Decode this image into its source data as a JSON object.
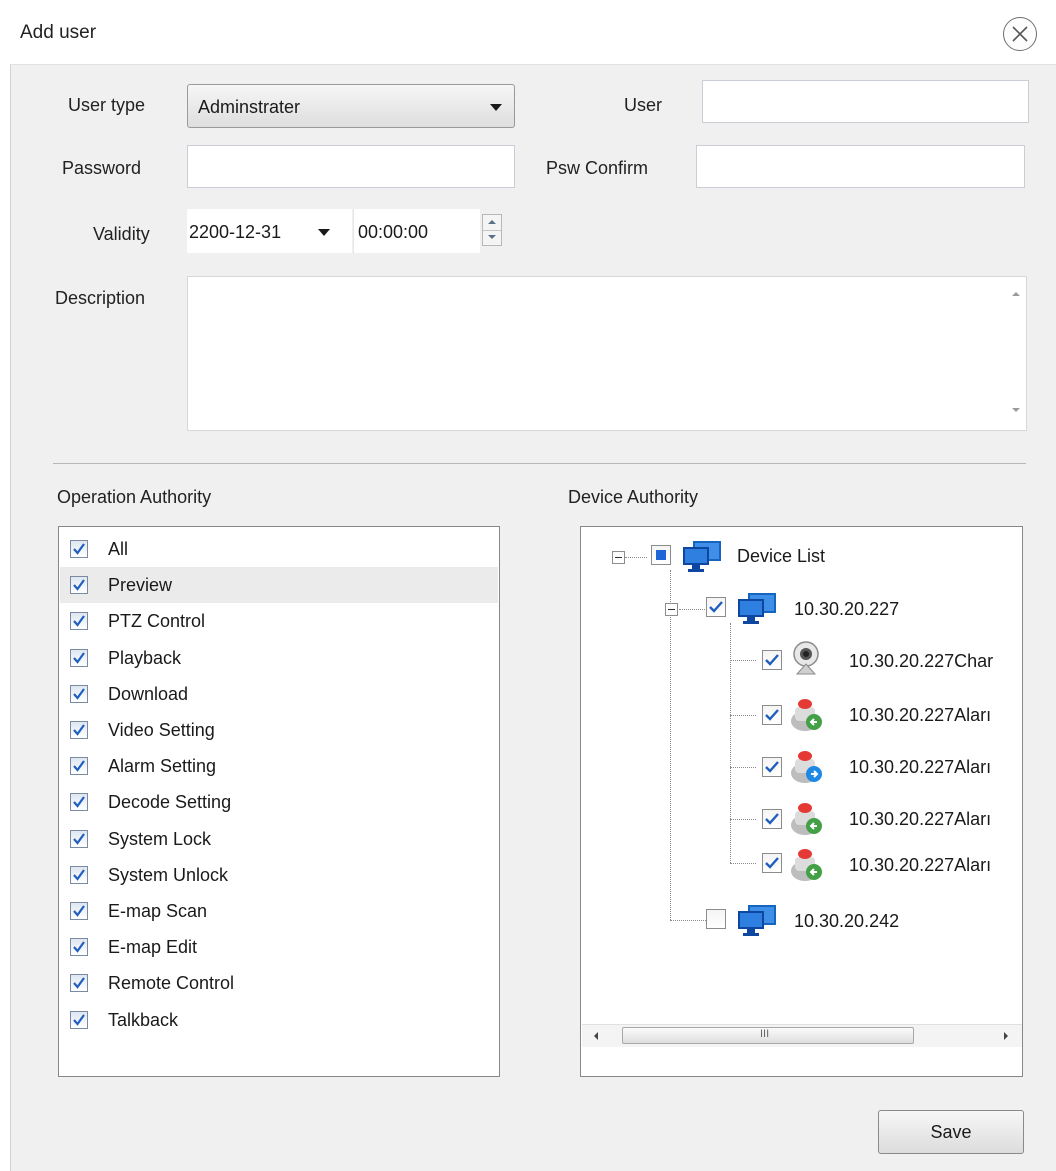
{
  "window": {
    "title": "Add user"
  },
  "form": {
    "user_type_label": "User type",
    "user_type_value": "Adminstrater",
    "user_label": "User",
    "user_value": "",
    "password_label": "Password",
    "password_value": "",
    "psw_confirm_label": "Psw Confirm",
    "psw_confirm_value": "",
    "validity_label": "Validity",
    "validity_date": "2200-12-31",
    "validity_time": "00:00:00",
    "description_label": "Description",
    "description_value": ""
  },
  "operation": {
    "heading": "Operation Authority",
    "items": [
      {
        "label": "All",
        "checked": true
      },
      {
        "label": "Preview",
        "checked": true,
        "selected": true
      },
      {
        "label": "PTZ Control",
        "checked": true
      },
      {
        "label": "Playback",
        "checked": true
      },
      {
        "label": "Download",
        "checked": true
      },
      {
        "label": "Video Setting",
        "checked": true
      },
      {
        "label": "Alarm Setting",
        "checked": true
      },
      {
        "label": "Decode Setting",
        "checked": true
      },
      {
        "label": "System Lock",
        "checked": true
      },
      {
        "label": "System Unlock",
        "checked": true
      },
      {
        "label": "E-map Scan",
        "checked": true
      },
      {
        "label": "E-map Edit",
        "checked": true
      },
      {
        "label": "Remote Control",
        "checked": true
      },
      {
        "label": "Talkback",
        "checked": true
      }
    ]
  },
  "device": {
    "heading": "Device Authority",
    "root": {
      "label": "Device List",
      "state": "partial",
      "icon": "monitor-icon"
    },
    "nodes": [
      {
        "label": "10.30.20.227",
        "checked": true,
        "icon": "monitor-icon"
      },
      {
        "label": "10.30.20.227Char",
        "checked": true,
        "icon": "webcam-icon"
      },
      {
        "label": "10.30.20.227Aları",
        "checked": true,
        "icon": "alarm-in-icon"
      },
      {
        "label": "10.30.20.227Aları",
        "checked": true,
        "icon": "alarm-out-icon"
      },
      {
        "label": "10.30.20.227Aları",
        "checked": true,
        "icon": "alarm-in-icon"
      },
      {
        "label": "10.30.20.227Aları",
        "checked": true,
        "icon": "alarm-in-icon"
      },
      {
        "label": "10.30.20.242",
        "checked": false,
        "icon": "monitor-icon"
      }
    ],
    "scroll_grip": "III"
  },
  "actions": {
    "save_label": "Save"
  },
  "colors": {
    "checkmark": "#1f5fbf",
    "partial": "#1e66d6"
  }
}
